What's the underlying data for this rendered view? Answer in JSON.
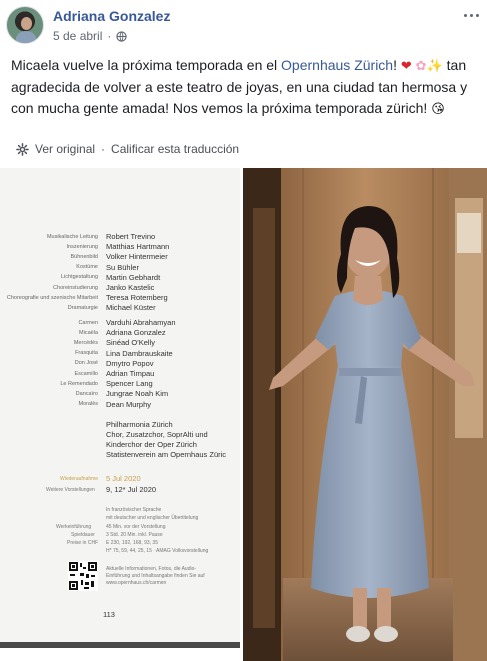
{
  "post": {
    "author": "Adriana Gonzalez",
    "date": "5 de abril",
    "date_separator": "·",
    "text_part1": "Micaela vuelve la próxima temporada en el ",
    "text_link": "Opernhaus Zürich",
    "text_part2": "! ",
    "text_part3": " tan agradecida de volver a este teatro de joyas, en una ciudad tan hermosa y con mucha gente amada! Nos vemos la próxima temporada zürich! ",
    "emoji_heart": "❤",
    "emoji_blossom": "✿",
    "emoji_sparkle": "✨",
    "emoji_kiss": "😘"
  },
  "translation": {
    "see_original": "Ver original",
    "separator": "·",
    "rate": "Calificar esta traducción"
  },
  "program": {
    "credits": [
      {
        "role": "Musikalische Leitung",
        "name": "Robert Trevino"
      },
      {
        "role": "Inszenierung",
        "name": "Matthias Hartmann"
      },
      {
        "role": "Bühnenbild",
        "name": "Volker Hintermeier"
      },
      {
        "role": "Kostüme",
        "name": "Su Bühler"
      },
      {
        "role": "Lichtgestaltung",
        "name": "Martin Gebhardt"
      },
      {
        "role": "Choreinstudierung",
        "name": "Janko Kastelic"
      },
      {
        "role": "Choreografie und szenische Mitarbeit",
        "name": "Teresa Rotemberg"
      },
      {
        "role": "Dramaturgie",
        "name": "Michael Küster"
      }
    ],
    "cast": [
      {
        "role": "Carmen",
        "name": "Varduhi Abrahamyan"
      },
      {
        "role": "Micaëla",
        "name": "Adriana Gonzalez"
      },
      {
        "role": "Mercédès",
        "name": "Sinéad O'Kelly"
      },
      {
        "role": "Frasquita",
        "name": "Lina Dambrauskaite"
      },
      {
        "role": "Don José",
        "name": "Dmytro Popov"
      },
      {
        "role": "Escamillo",
        "name": "Adrian Timpau"
      },
      {
        "role": "Le Remendado",
        "name": "Spencer Lang"
      },
      {
        "role": "Dancaïro",
        "name": "Jungrae Noah Kim"
      },
      {
        "role": "Moralès",
        "name": "Dean Murphy"
      }
    ],
    "ensembles": [
      "Philharmonia Zürich",
      "Chor, Zusatzchor, SoprAlti und",
      "Kinderchor der Oper Zürich",
      "Statistenverein am Opernhaus Züric"
    ],
    "revival_label": "Wiederaufnahme",
    "revival_date": "5 Jul 2020",
    "more_label": "Weitere Vorstellungen",
    "more_dates": "9, 12* Jul 2020",
    "lang_1": "In französischer Sprache",
    "lang_2": "mit deutscher und englischer Übertitelung",
    "intro_label": "Werkeinführung",
    "intro_val": "45 Min. vor der Vorstellung",
    "duration_label": "Spieldauer",
    "duration_val": "3 Std. 20 Min. inkl. Pause",
    "price_label": "Preise in CHF",
    "price_val_1": "E 230, 192, 168, 93, 35",
    "price_val_2": "H* 75, 59, 44, 25, 15 · AMAG Volksvorstellung",
    "info_1": "Aktuelle Informationen, Fotos, die Audio-",
    "info_2": "Einführung und Inhaltsangabe finden Sie auf",
    "info_3": "www.opernhaus.ch/carmen",
    "page_number": "113"
  },
  "colors": {
    "link": "#385898",
    "secondary_text": "#606770",
    "revival_gold": "#c8a14b"
  },
  "icons": [
    "globe-icon",
    "more-options-icon",
    "gear-icon"
  ]
}
